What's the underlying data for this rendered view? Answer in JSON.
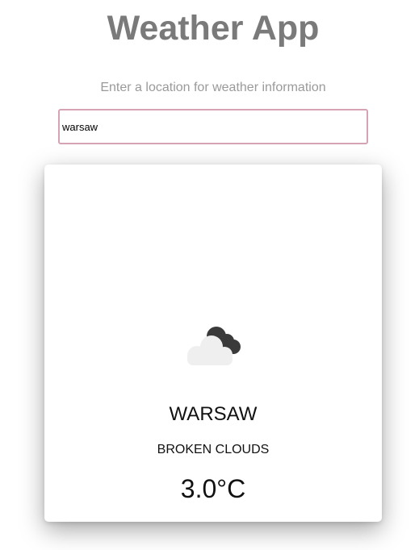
{
  "app": {
    "title": "Weather App"
  },
  "search": {
    "prompt": "Enter a location for weather information",
    "value": "warsaw"
  },
  "weather": {
    "icon": "broken-clouds-icon",
    "city": "WARSAW",
    "condition": "BROKEN CLOUDS",
    "temperature": "3.0°C"
  },
  "colors": {
    "title": "#7a7a7a",
    "prompt": "#9a9a9a",
    "input_border": "#d6a3b4",
    "cloud_dark": "#3a3a3a",
    "cloud_light": "#efefef"
  }
}
